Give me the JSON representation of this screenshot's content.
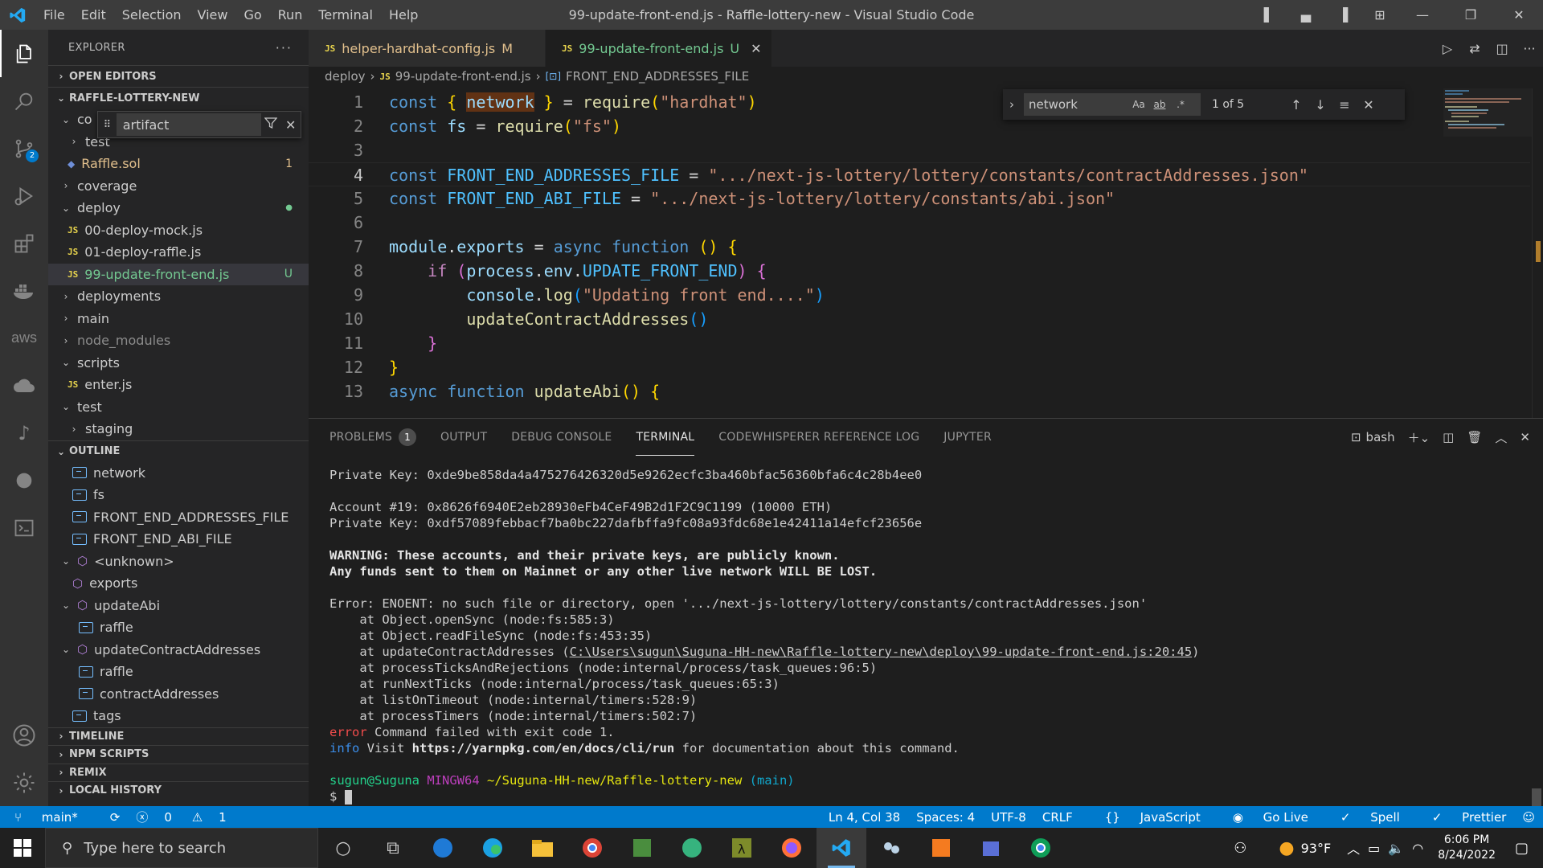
{
  "window": {
    "title": "99-update-front-end.js - Raffle-lottery-new - Visual Studio Code",
    "menu": [
      "File",
      "Edit",
      "Selection",
      "View",
      "Go",
      "Run",
      "Terminal",
      "Help"
    ]
  },
  "activity_bar": {
    "source_control_badge": "2"
  },
  "explorer": {
    "header": "EXPLORER",
    "open_editors": "OPEN EDITORS",
    "project": "RAFFLE-LOTTERY-NEW",
    "filter_value": "artifact",
    "tree": [
      {
        "label": "co",
        "kind": "folder-open",
        "indent": 1
      },
      {
        "label": "test",
        "kind": "folder",
        "indent": 2
      },
      {
        "label": "Raffle.sol",
        "kind": "sol",
        "indent": 2,
        "deco": "1",
        "color": "#e2c08d"
      },
      {
        "label": "coverage",
        "kind": "folder",
        "indent": 1
      },
      {
        "label": "deploy",
        "kind": "folder-open",
        "indent": 1,
        "deco": "●",
        "color": "#73c991"
      },
      {
        "label": "00-deploy-mock.js",
        "kind": "js",
        "indent": 2
      },
      {
        "label": "01-deploy-raffle.js",
        "kind": "js",
        "indent": 2
      },
      {
        "label": "99-update-front-end.js",
        "kind": "js",
        "indent": 2,
        "deco": "U",
        "color": "#73c991",
        "selected": true
      },
      {
        "label": "deployments",
        "kind": "folder",
        "indent": 1
      },
      {
        "label": "main",
        "kind": "folder",
        "indent": 1
      },
      {
        "label": "node_modules",
        "kind": "folder",
        "indent": 1,
        "dim": true
      },
      {
        "label": "scripts",
        "kind": "folder-open",
        "indent": 1
      },
      {
        "label": "enter.js",
        "kind": "js",
        "indent": 2
      },
      {
        "label": "test",
        "kind": "folder-open",
        "indent": 1
      },
      {
        "label": "staging",
        "kind": "folder",
        "indent": 2
      }
    ],
    "outline_title": "OUTLINE",
    "outline": [
      {
        "label": "network",
        "kind": "var",
        "indent": 1
      },
      {
        "label": "fs",
        "kind": "var",
        "indent": 1
      },
      {
        "label": "FRONT_END_ADDRESSES_FILE",
        "kind": "var",
        "indent": 1
      },
      {
        "label": "FRONT_END_ABI_FILE",
        "kind": "var",
        "indent": 1
      },
      {
        "label": "<unknown>",
        "kind": "module-open",
        "indent": 0
      },
      {
        "label": "exports",
        "kind": "module",
        "indent": 1
      },
      {
        "label": "updateAbi",
        "kind": "module-open",
        "indent": 0
      },
      {
        "label": "raffle",
        "kind": "var",
        "indent": 2
      },
      {
        "label": "updateContractAddresses",
        "kind": "module-open",
        "indent": 0
      },
      {
        "label": "raffle",
        "kind": "var",
        "indent": 2
      },
      {
        "label": "contractAddresses",
        "kind": "var",
        "indent": 2
      },
      {
        "label": "tags",
        "kind": "var",
        "indent": 1
      }
    ],
    "bottom_sections": [
      "TIMELINE",
      "NPM SCRIPTS",
      "REMIX",
      "LOCAL HISTORY"
    ]
  },
  "tabs": [
    {
      "label": "helper-hardhat-config.js",
      "status": "M",
      "active": false
    },
    {
      "label": "99-update-front-end.js",
      "status": "U",
      "active": true
    }
  ],
  "breadcrumb": [
    "deploy",
    "99-update-front-end.js",
    "FRONT_END_ADDRESSES_FILE"
  ],
  "find": {
    "value": "network",
    "opt_case": "Aa",
    "opt_word": "ab",
    "opt_regex": ".*",
    "count": "1 of 5"
  },
  "code_lines": [
    {
      "n": "1",
      "tokens": [
        [
          "kw",
          "const "
        ],
        [
          "br1",
          "{ "
        ],
        [
          "var hl",
          "network"
        ],
        [
          "br1",
          " }"
        ],
        [
          "plain",
          " = "
        ],
        [
          "fn",
          "require"
        ],
        [
          "br1",
          "("
        ],
        [
          "str",
          "\"hardhat\""
        ],
        [
          "br1",
          ")"
        ]
      ]
    },
    {
      "n": "2",
      "tokens": [
        [
          "kw",
          "const "
        ],
        [
          "var",
          "fs"
        ],
        [
          "plain",
          " = "
        ],
        [
          "fn",
          "require"
        ],
        [
          "br1",
          "("
        ],
        [
          "str",
          "\"fs\""
        ],
        [
          "br1",
          ")"
        ]
      ]
    },
    {
      "n": "3",
      "tokens": []
    },
    {
      "n": "4",
      "tokens": [
        [
          "kw",
          "const "
        ],
        [
          "cst",
          "FRONT_END_ADDRESSES_FILE"
        ],
        [
          "plain",
          " = "
        ],
        [
          "str",
          "\".../next-js-lottery/lottery/constants/contractAddresses.json\""
        ]
      ]
    },
    {
      "n": "5",
      "tokens": [
        [
          "kw",
          "const "
        ],
        [
          "cst",
          "FRONT_END_ABI_FILE"
        ],
        [
          "plain",
          " = "
        ],
        [
          "str",
          "\".../next-js-lottery/lottery/constants/abi.json\""
        ]
      ]
    },
    {
      "n": "6",
      "tokens": []
    },
    {
      "n": "7",
      "tokens": [
        [
          "var",
          "module"
        ],
        [
          "plain",
          "."
        ],
        [
          "var",
          "exports"
        ],
        [
          "plain",
          " = "
        ],
        [
          "kw",
          "async function "
        ],
        [
          "br1",
          "() {"
        ]
      ]
    },
    {
      "n": "8",
      "tokens": [
        [
          "plain",
          "    "
        ],
        [
          "ctl",
          "if "
        ],
        [
          "br2",
          "("
        ],
        [
          "var",
          "process"
        ],
        [
          "plain",
          "."
        ],
        [
          "var",
          "env"
        ],
        [
          "plain",
          "."
        ],
        [
          "cst",
          "UPDATE_FRONT_END"
        ],
        [
          "br2",
          ")"
        ],
        [
          "br2",
          " {"
        ]
      ]
    },
    {
      "n": "9",
      "tokens": [
        [
          "plain",
          "        "
        ],
        [
          "var",
          "console"
        ],
        [
          "plain",
          "."
        ],
        [
          "fn",
          "log"
        ],
        [
          "br3",
          "("
        ],
        [
          "str",
          "\"Updating front end....\""
        ],
        [
          "br3",
          ")"
        ]
      ]
    },
    {
      "n": "10",
      "tokens": [
        [
          "plain",
          "        "
        ],
        [
          "fn",
          "updateContractAddresses"
        ],
        [
          "br3",
          "()"
        ]
      ]
    },
    {
      "n": "11",
      "tokens": [
        [
          "plain",
          "    "
        ],
        [
          "br2",
          "}"
        ]
      ]
    },
    {
      "n": "12",
      "tokens": [
        [
          "br1",
          "}"
        ]
      ]
    },
    {
      "n": "13",
      "tokens": [
        [
          "kw",
          "async function "
        ],
        [
          "fn",
          "updateAbi"
        ],
        [
          "br1",
          "() {"
        ]
      ]
    }
  ],
  "panel": {
    "tabs": [
      "PROBLEMS",
      "OUTPUT",
      "DEBUG CONSOLE",
      "TERMINAL",
      "CODEWHISPERER REFERENCE LOG",
      "JUPYTER"
    ],
    "problems_badge": "1",
    "shell": "bash"
  },
  "terminal_lines": [
    [
      [
        "",
        "Private Key: 0xde9be858da4a475276426320d5e9262ecfc3ba460bfac56360bfa6c4c28b4ee0"
      ]
    ],
    [],
    [
      [
        "",
        "Account #19: 0x8626f6940E2eb28930eFb4CeF49B2d1F2C9C1199 (10000 ETH)"
      ]
    ],
    [
      [
        "",
        "Private Key: 0xdf57089febbacf7ba0bc227dafbffa9fc08a93fdc68e1e42411a14efcf23656e"
      ]
    ],
    [],
    [
      [
        "bold",
        "WARNING: These accounts, and their private keys, are publicly known."
      ]
    ],
    [
      [
        "bold",
        "Any funds sent to them on Mainnet or any other live network WILL BE LOST."
      ]
    ],
    [],
    [
      [
        "",
        "Error: ENOENT: no such file or directory, open '.../next-js-lottery/lottery/constants/contractAddresses.json'"
      ]
    ],
    [
      [
        "",
        "    at Object.openSync (node:fs:585:3)"
      ]
    ],
    [
      [
        "",
        "    at Object.readFileSync (node:fs:453:35)"
      ]
    ],
    [
      [
        "",
        "    at updateContractAddresses ("
      ],
      [
        "ul",
        "C:\\Users\\sugun\\Suguna-HH-new\\Raffle-lottery-new\\deploy\\99-update-front-end.js:20:45"
      ],
      [
        "",
        ")"
      ]
    ],
    [
      [
        "",
        "    at processTicksAndRejections (node:internal/process/task_queues:96:5)"
      ]
    ],
    [
      [
        "",
        "    at runNextTicks (node:internal/process/task_queues:65:3)"
      ]
    ],
    [
      [
        "",
        "    at listOnTimeout (node:internal/timers:528:9)"
      ]
    ],
    [
      [
        "",
        "    at processTimers (node:internal/timers:502:7)"
      ]
    ],
    [
      [
        "err",
        "error"
      ],
      [
        "",
        " Command failed with exit code 1."
      ]
    ],
    [
      [
        "info",
        "info"
      ],
      [
        "",
        " Visit "
      ],
      [
        "bold",
        "https://yarnpkg.com/en/docs/cli/run"
      ],
      [
        "",
        " for documentation about this command."
      ]
    ],
    [],
    [
      [
        "tgreen",
        "sugun@Suguna"
      ],
      [
        "",
        " "
      ],
      [
        "tpurple",
        "MINGW64"
      ],
      [
        "",
        " "
      ],
      [
        "tyellow",
        "~/Suguna-HH-new/Raffle-lottery-new"
      ],
      [
        "",
        " "
      ],
      [
        "tcyan",
        "(main)"
      ]
    ],
    [
      [
        "",
        "$ "
      ],
      [
        "cursor",
        ""
      ]
    ]
  ],
  "status": {
    "branch": "main*",
    "sync": "⟳",
    "errors": "0",
    "warnings": "1",
    "position": "Ln 4, Col 38",
    "spaces": "Spaces: 4",
    "encoding": "UTF-8",
    "eol": "CRLF",
    "language": "JavaScript",
    "golive": "Go Live",
    "spell": "Spell",
    "prettier": "Prettier"
  },
  "taskbar": {
    "search_placeholder": "Type here to search",
    "weather": "93°F",
    "time": "6:06 PM",
    "date": "8/24/2022"
  }
}
